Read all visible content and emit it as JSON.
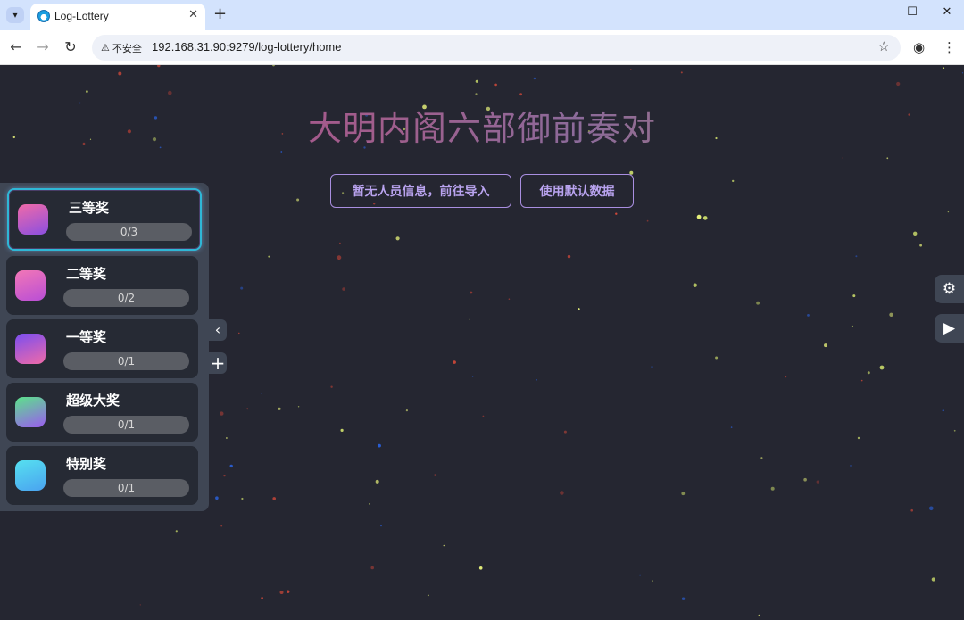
{
  "browser": {
    "tab_title": "Log-Lottery",
    "url": "192.168.31.90:9279/log-lottery/home",
    "security_label": "不安全"
  },
  "page": {
    "title": "大明内阁六部御前奏对",
    "buttons": {
      "import_label": "暂无人员信息，前往导入",
      "default_data_label": "使用默认数据"
    }
  },
  "prizes": [
    {
      "name": "三等奖",
      "count": "0/3",
      "active": true,
      "gradient": [
        "#f06aa8",
        "#8b4fe0"
      ]
    },
    {
      "name": "二等奖",
      "count": "0/2",
      "active": false,
      "gradient": [
        "#f277b6",
        "#b94ed6"
      ]
    },
    {
      "name": "一等奖",
      "count": "0/1",
      "active": false,
      "gradient": [
        "#7a4ef0",
        "#f06aa8"
      ]
    },
    {
      "name": "超级大奖",
      "count": "0/1",
      "active": false,
      "gradient": [
        "#5be38a",
        "#9a5cf0"
      ]
    },
    {
      "name": "特别奖",
      "count": "0/1",
      "active": false,
      "gradient": [
        "#56e0f0",
        "#4aa3f0"
      ]
    }
  ],
  "colors": {
    "background": "#252631",
    "panel": "#3f4654",
    "card": "#262a34",
    "accent_border": "#a98ee0"
  },
  "icons": {
    "collapse": "chevron-left-icon",
    "add": "plus-icon",
    "settings": "gear-icon",
    "play": "play-icon"
  }
}
